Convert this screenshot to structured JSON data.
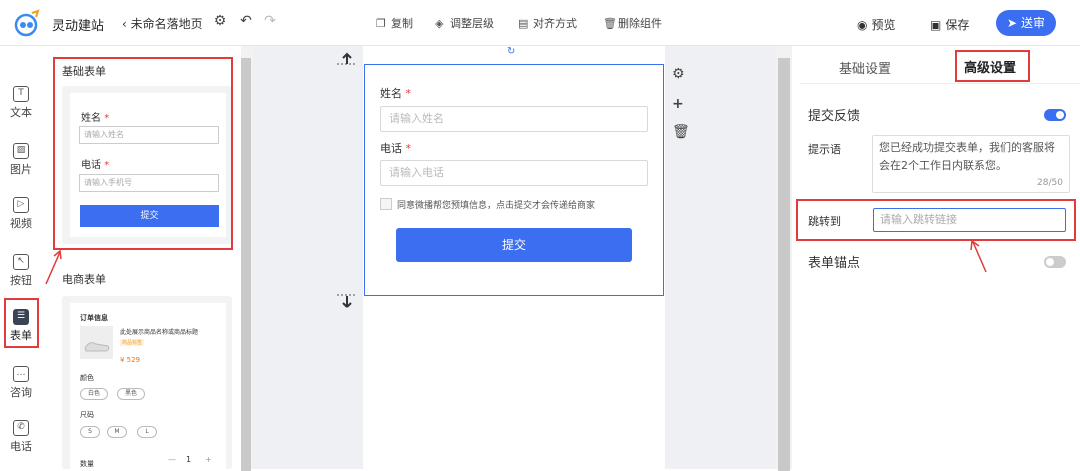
{
  "header": {
    "brand": "灵动建站",
    "page_name": "未命名落地页",
    "tools": {
      "copy": "复制",
      "layer": "调整层级",
      "align": "对齐方式",
      "delete": "删除组件"
    },
    "preview": "预览",
    "save": "保存",
    "send": "送审"
  },
  "leftnav": {
    "items": [
      {
        "label": "文本",
        "glyph": "T"
      },
      {
        "label": "图片",
        "glyph": "▨"
      },
      {
        "label": "视频",
        "glyph": "▷"
      },
      {
        "label": "按钮",
        "glyph": "↖"
      },
      {
        "label": "表单",
        "glyph": "☰"
      },
      {
        "label": "咨询",
        "glyph": "…"
      },
      {
        "label": "电话",
        "glyph": "✆"
      }
    ]
  },
  "component_panel": {
    "basic_form": {
      "title": "基础表单",
      "name_label": "姓名",
      "name_placeholder": "请输入姓名",
      "phone_label": "电话",
      "phone_placeholder": "请输入手机号",
      "submit": "提交"
    },
    "ecommerce_form": {
      "title": "电商表单",
      "order_info": "订单信息",
      "product_title": "此处展示商品名称或商品标题",
      "tag": "商品标签",
      "price": "¥ 529",
      "color_label": "颜色",
      "colors": [
        "白色",
        "黑色"
      ],
      "size_label": "尺码",
      "sizes": [
        "S",
        "M",
        "L"
      ],
      "qty_label": "数量",
      "qty_minus": "—",
      "qty": "1",
      "qty_plus": "+"
    }
  },
  "canvas_form": {
    "name_label": "姓名",
    "name_placeholder": "请输入姓名",
    "phone_label": "电话",
    "phone_placeholder": "请输入电话",
    "consent": "同意微播帮您预填信息，点击提交才会传递给商家",
    "submit": "提交",
    "required_mark": "*"
  },
  "settings": {
    "tab_basic": "基础设置",
    "tab_advanced": "高级设置",
    "feedback_label": "提交反馈",
    "feedback_on": true,
    "tip_label": "提示语",
    "tip_text": "您已经成功提交表单，我们的客服将会在2个工作日内联系您。",
    "tip_count": "28/50",
    "jump_label": "跳转到",
    "jump_placeholder": "请输入跳转链接",
    "anchor_label": "表单锚点",
    "anchor_on": false
  },
  "colors": {
    "accent": "#3b6ef0",
    "highlight": "#e23b3b"
  }
}
